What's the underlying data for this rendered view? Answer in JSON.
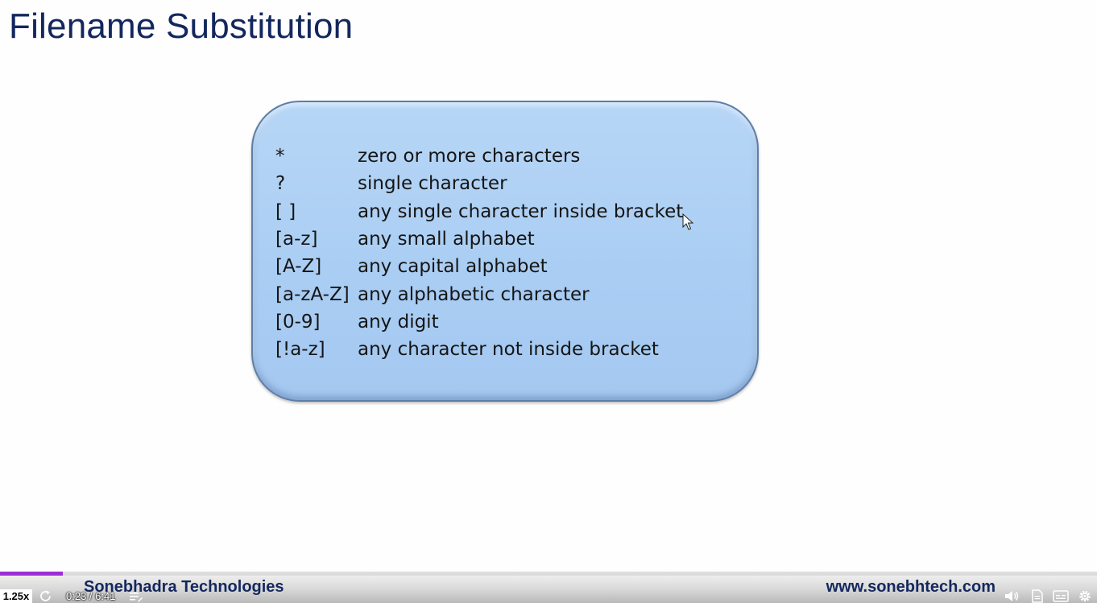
{
  "slide": {
    "title": "Filename Substitution",
    "patterns": [
      {
        "symbol": "*",
        "description": "zero or more characters"
      },
      {
        "symbol": "?",
        "description": "single character"
      },
      {
        "symbol": "[ ]",
        "description": "any single character inside bracket"
      },
      {
        "symbol": "[a-z]",
        "description": "any small alphabet"
      },
      {
        "symbol": "[A-Z]",
        "description": "any capital alphabet"
      },
      {
        "symbol": "[a-zA-Z]",
        "description": "any alphabetic character"
      },
      {
        "symbol": "[0-9]",
        "description": "any digit"
      },
      {
        "symbol": "[!a-z]",
        "description": "any character not inside bracket"
      }
    ]
  },
  "footer": {
    "company": "Sonebhadra Technologies",
    "website": "www.sonebhtech.com"
  },
  "player": {
    "speed": "1.25x",
    "time": "0:23 / 6:41",
    "progress_fraction": 0.057,
    "progress_color": "#9b2fd6",
    "icons": [
      "replay-icon",
      "chapters-icon",
      "volume-icon",
      "notes-icon",
      "captions-icon",
      "settings-icon"
    ]
  },
  "colors": {
    "title": "#13275e",
    "box_fill": "#a9cdf3",
    "footer_text": "#14285e"
  }
}
